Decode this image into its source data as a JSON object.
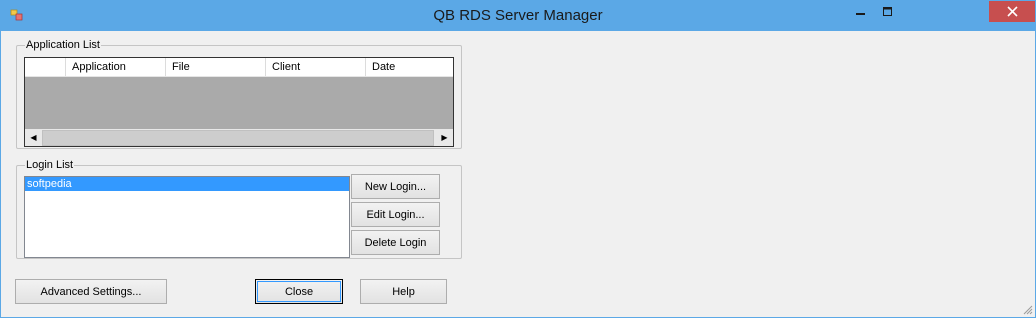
{
  "window": {
    "title": "QB RDS Server Manager"
  },
  "titlebar": {
    "minimize_glyph": "—",
    "maximize_glyph": "☐",
    "close_glyph": "✕"
  },
  "app_list": {
    "legend": "Application List",
    "columns": [
      "",
      "Application",
      "File",
      "Client",
      "Date"
    ],
    "rows": []
  },
  "login_list": {
    "legend": "Login List",
    "items": [
      {
        "label": "softpedia",
        "selected": true
      }
    ],
    "buttons": {
      "new": "New Login...",
      "edit": "Edit Login...",
      "delete": "Delete Login"
    }
  },
  "footer": {
    "advanced": "Advanced Settings...",
    "close": "Close",
    "help": "Help"
  },
  "colors": {
    "titlebar": "#5ba8e6",
    "close_button": "#c74f4f",
    "selection": "#3399ff",
    "listview_empty": "#aaaaaa"
  },
  "icons": [
    "app-icon",
    "minimize-icon",
    "maximize-icon",
    "close-icon",
    "scroll-left-arrow-icon",
    "scroll-right-arrow-icon",
    "resize-grip-icon"
  ]
}
